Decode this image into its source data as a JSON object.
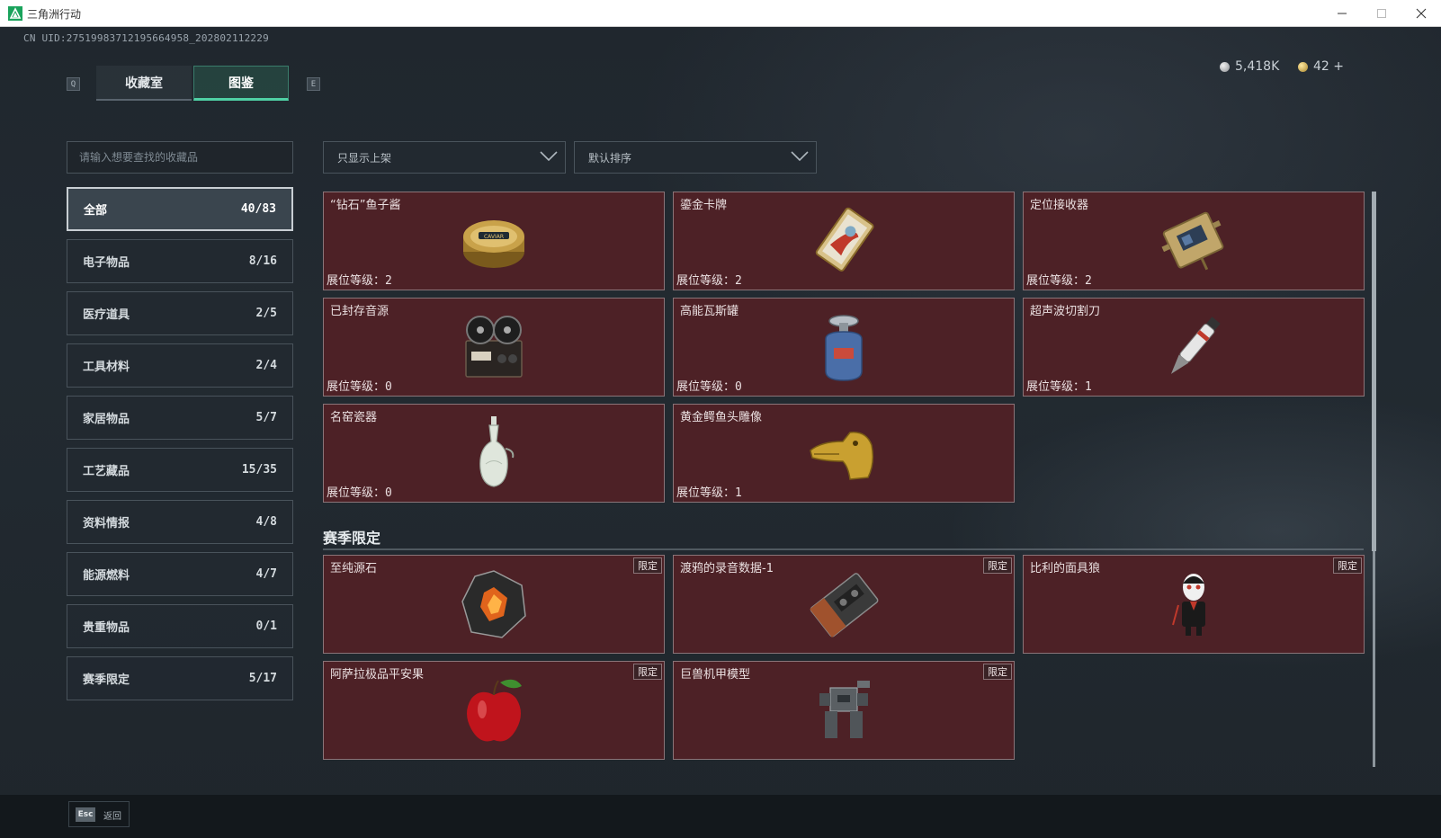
{
  "window": {
    "title": "三角洲行动",
    "accent": "#1aa35c"
  },
  "header": {
    "uid": "CN UID:27519983712195664958_202802112229",
    "key_left": "Q",
    "key_right": "E",
    "tabs": [
      {
        "label": "收藏室",
        "active": false
      },
      {
        "label": "图鉴",
        "active": true
      }
    ],
    "currency": [
      {
        "icon": "silver-coin-icon",
        "value": "5,418K"
      },
      {
        "icon": "gold-coin-icon",
        "value": "42 +"
      }
    ]
  },
  "search": {
    "placeholder": "请输入想要查找的收藏品",
    "value": ""
  },
  "categories": [
    {
      "label": "全部",
      "count": "40/83",
      "active": true
    },
    {
      "label": "电子物品",
      "count": "8/16"
    },
    {
      "label": "医疗道具",
      "count": "2/5"
    },
    {
      "label": "工具材料",
      "count": "2/4"
    },
    {
      "label": "家居物品",
      "count": "5/7"
    },
    {
      "label": "工艺藏品",
      "count": "15/35"
    },
    {
      "label": "资料情报",
      "count": "4/8"
    },
    {
      "label": "能源燃料",
      "count": "4/7"
    },
    {
      "label": "贵重物品",
      "count": "0/1"
    },
    {
      "label": "赛季限定",
      "count": "5/17"
    }
  ],
  "filters": {
    "shelf": "只显示上架",
    "sort": "默认排序"
  },
  "level_label": "展位等级：",
  "limited_label": "限定",
  "items": [
    {
      "name": "“钻石”鱼子酱",
      "level": "2",
      "icon": "caviar-tin-icon"
    },
    {
      "name": "鎏金卡牌",
      "level": "2",
      "icon": "gilded-card-icon"
    },
    {
      "name": "定位接收器",
      "level": "2",
      "icon": "receiver-device-icon"
    },
    {
      "name": "已封存音源",
      "level": "0",
      "icon": "reel-recorder-icon"
    },
    {
      "name": "高能瓦斯罐",
      "level": "0",
      "icon": "gas-canister-icon"
    },
    {
      "name": "超声波切割刀",
      "level": "1",
      "icon": "ultrasonic-cutter-icon"
    },
    {
      "name": "名窑瓷器",
      "level": "0",
      "icon": "porcelain-vase-icon"
    },
    {
      "name": "黄金鳄鱼头雕像",
      "level": "1",
      "icon": "golden-crocodile-icon"
    }
  ],
  "season": {
    "title": "赛季限定",
    "items": [
      {
        "name": "至纯源石",
        "icon": "source-stone-icon"
      },
      {
        "name": "渡鸦的录音数据-1",
        "icon": "cassette-tape-icon"
      },
      {
        "name": "比利的面具狼",
        "icon": "billy-puppet-icon"
      },
      {
        "name": "阿萨拉极品平安果",
        "icon": "red-apple-icon"
      },
      {
        "name": "巨兽机甲模型",
        "icon": "mech-model-icon"
      }
    ]
  },
  "footer": {
    "key": "Esc",
    "label": "返回"
  }
}
